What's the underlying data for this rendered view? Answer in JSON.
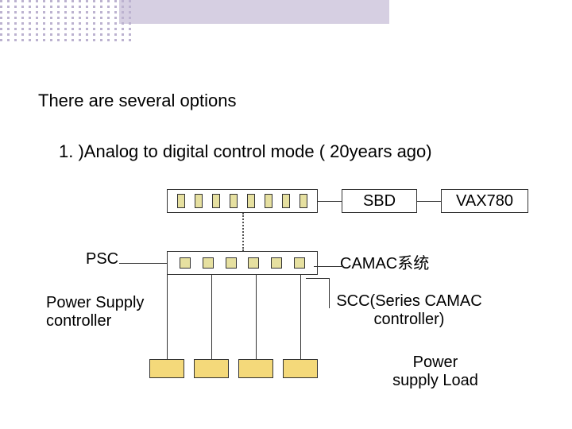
{
  "header": {
    "title": "There are several options",
    "subtitle": "1. )Analog to digital  control  mode ( 20years ago)"
  },
  "diagram": {
    "sbd_label": "SBD",
    "vax_label": "VAX780",
    "psc_label": "PSC",
    "power_supply_controller": "Power Supply controller",
    "camac_system": "CAMAC系统",
    "scc": "SCC(Series CAMAC controller)",
    "load": "Power supply Load"
  }
}
